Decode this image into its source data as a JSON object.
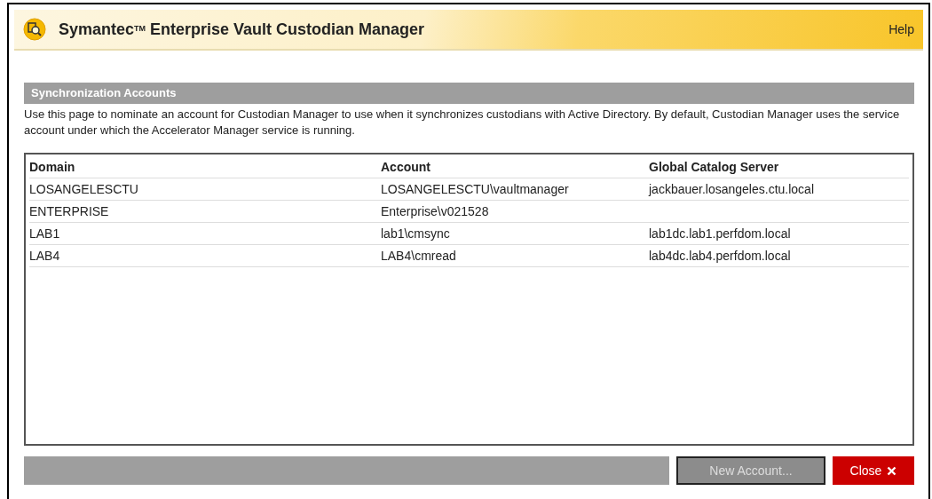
{
  "header": {
    "title_prefix": "Symantec",
    "trademark": "TM",
    "title": "Enterprise Vault Custodian Manager",
    "help": "Help"
  },
  "section": {
    "title": "Synchronization Accounts",
    "description": "Use this page to nominate an account for Custodian Manager to use when it synchronizes custodians with Active Directory. By default, Custodian Manager uses the service account under which the Accelerator Manager service is running."
  },
  "table": {
    "columns": [
      "Domain",
      "Account",
      "Global Catalog Server"
    ],
    "rows": [
      [
        "LOSANGELESCTU",
        "LOSANGELESCTU\\vaultmanager",
        "jackbauer.losangeles.ctu.local"
      ],
      [
        "ENTERPRISE",
        "Enterprise\\v021528",
        ""
      ],
      [
        "LAB1",
        "lab1\\cmsync",
        "lab1dc.lab1.perfdom.local"
      ],
      [
        "LAB4",
        "LAB4\\cmread",
        "lab4dc.lab4.perfdom.local"
      ]
    ]
  },
  "buttons": [
    {
      "label": "New Account...",
      "kind": "secondary",
      "disabled": true
    },
    {
      "label": "Close",
      "kind": "close",
      "disabled": false
    }
  ]
}
